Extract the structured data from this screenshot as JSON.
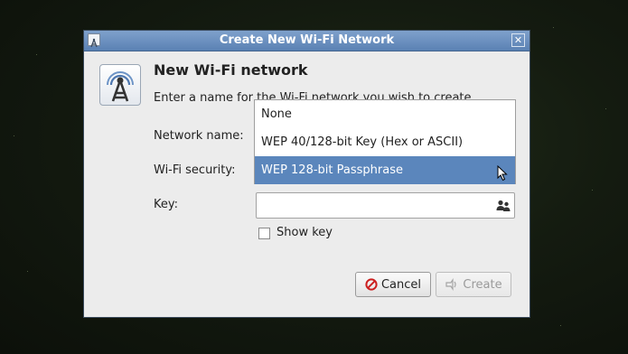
{
  "window": {
    "title": "Create New Wi-Fi Network"
  },
  "dialog": {
    "heading": "New Wi-Fi network",
    "description": "Enter a name for the Wi-Fi network you wish to create.",
    "network_name_label": "Network name:",
    "wifi_security_label": "Wi-Fi security:",
    "key_label": "Key:",
    "key_value": "",
    "show_key_label": "Show key",
    "show_key_checked": false
  },
  "security_dropdown": {
    "options": [
      "None",
      "WEP 40/128-bit Key (Hex or ASCII)",
      "WEP 128-bit Passphrase"
    ],
    "highlighted": "WEP 128-bit Passphrase"
  },
  "buttons": {
    "cancel": "Cancel",
    "create": "Create",
    "create_enabled": false
  },
  "icons": {
    "title": "wifi-tower-icon",
    "main": "wifi-tower-icon",
    "close": "close-icon",
    "key_field": "people-icon",
    "cancel": "cancel-icon",
    "create": "create-network-icon"
  },
  "colors": {
    "titlebar": "#6a8fc0",
    "selection": "#5b86bc",
    "window_bg": "#ececec",
    "cancel_icon": "#cc1f1f"
  }
}
